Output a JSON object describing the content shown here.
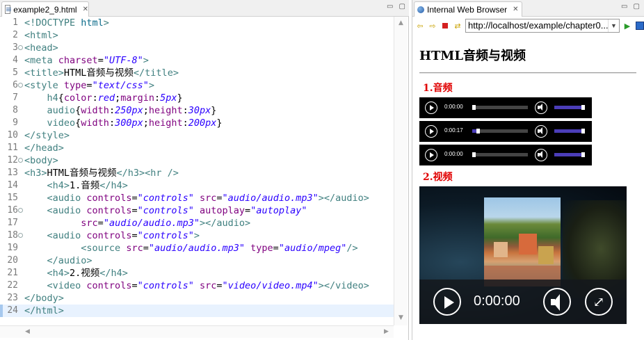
{
  "editor": {
    "tab_label": "example2_9.html",
    "tab_close": "✕",
    "min_label": "▭",
    "max_label": "▢",
    "lines": [
      {
        "n": "1",
        "parts": [
          [
            "t",
            "<!DOCTYPE "
          ],
          [
            "k",
            "html"
          ],
          [
            "t",
            ">"
          ]
        ]
      },
      {
        "n": "2",
        "parts": [
          [
            "t",
            "<html>"
          ]
        ]
      },
      {
        "n": "3",
        "fold": true,
        "parts": [
          [
            "t",
            "<head>"
          ]
        ]
      },
      {
        "n": "4",
        "parts": [
          [
            "t",
            "<meta "
          ],
          [
            "a",
            "charset"
          ],
          [
            "txt",
            "="
          ],
          [
            "v",
            "\"UTF-8\""
          ],
          [
            "t",
            ">"
          ]
        ]
      },
      {
        "n": "5",
        "parts": [
          [
            "t",
            "<title>"
          ],
          [
            "txt",
            "HTML音频与视频"
          ],
          [
            "t",
            "</title>"
          ]
        ]
      },
      {
        "n": "6",
        "fold": true,
        "parts": [
          [
            "t",
            "<style "
          ],
          [
            "a",
            "type"
          ],
          [
            "txt",
            "="
          ],
          [
            "v",
            "\"text/css\""
          ],
          [
            "t",
            ">"
          ]
        ]
      },
      {
        "n": "7",
        "parts": [
          [
            "txt",
            "    "
          ],
          [
            "sel",
            "h4"
          ],
          [
            "txt",
            "{"
          ],
          [
            "prop",
            "color"
          ],
          [
            "txt",
            ":"
          ],
          [
            "pv",
            "red"
          ],
          [
            "txt",
            ";"
          ],
          [
            "prop",
            "margin"
          ],
          [
            "txt",
            ":"
          ],
          [
            "pv",
            "5px"
          ],
          [
            "txt",
            "}"
          ]
        ]
      },
      {
        "n": "8",
        "parts": [
          [
            "txt",
            "    "
          ],
          [
            "sel",
            "audio"
          ],
          [
            "txt",
            "{"
          ],
          [
            "prop",
            "width"
          ],
          [
            "txt",
            ":"
          ],
          [
            "pv",
            "250px"
          ],
          [
            "txt",
            ";"
          ],
          [
            "prop",
            "height"
          ],
          [
            "txt",
            ":"
          ],
          [
            "pv",
            "30px"
          ],
          [
            "txt",
            "}"
          ]
        ]
      },
      {
        "n": "9",
        "parts": [
          [
            "txt",
            "    "
          ],
          [
            "sel",
            "video"
          ],
          [
            "txt",
            "{"
          ],
          [
            "prop",
            "width"
          ],
          [
            "txt",
            ":"
          ],
          [
            "pv",
            "300px"
          ],
          [
            "txt",
            ";"
          ],
          [
            "prop",
            "height"
          ],
          [
            "txt",
            ":"
          ],
          [
            "pv",
            "200px"
          ],
          [
            "txt",
            "}"
          ]
        ]
      },
      {
        "n": "10",
        "parts": [
          [
            "t",
            "</style>"
          ]
        ]
      },
      {
        "n": "11",
        "parts": [
          [
            "t",
            "</head>"
          ]
        ]
      },
      {
        "n": "12",
        "fold": true,
        "parts": [
          [
            "t",
            "<body>"
          ]
        ]
      },
      {
        "n": "13",
        "parts": [
          [
            "t",
            "<h3>"
          ],
          [
            "txt",
            "HTML音频与视频"
          ],
          [
            "t",
            "</h3><hr />"
          ]
        ]
      },
      {
        "n": "14",
        "parts": [
          [
            "txt",
            "    "
          ],
          [
            "t",
            "<h4>"
          ],
          [
            "txt",
            "1.音频"
          ],
          [
            "t",
            "</h4>"
          ]
        ]
      },
      {
        "n": "15",
        "parts": [
          [
            "txt",
            "    "
          ],
          [
            "t",
            "<audio "
          ],
          [
            "a",
            "controls"
          ],
          [
            "txt",
            "="
          ],
          [
            "v",
            "\"controls\""
          ],
          [
            "txt",
            " "
          ],
          [
            "a",
            "src"
          ],
          [
            "txt",
            "="
          ],
          [
            "v",
            "\"audio/audio.mp3\""
          ],
          [
            "t",
            "></audio>"
          ]
        ]
      },
      {
        "n": "16",
        "fold": true,
        "parts": [
          [
            "txt",
            "    "
          ],
          [
            "t",
            "<audio "
          ],
          [
            "a",
            "controls"
          ],
          [
            "txt",
            "="
          ],
          [
            "v",
            "\"controls\""
          ],
          [
            "txt",
            " "
          ],
          [
            "a",
            "autoplay"
          ],
          [
            "txt",
            "="
          ],
          [
            "v",
            "\"autoplay\""
          ]
        ]
      },
      {
        "n": "17",
        "parts": [
          [
            "txt",
            "          "
          ],
          [
            "a",
            "src"
          ],
          [
            "txt",
            "="
          ],
          [
            "v",
            "\"audio/audio.mp3\""
          ],
          [
            "t",
            "></audio>"
          ]
        ]
      },
      {
        "n": "18",
        "fold": true,
        "parts": [
          [
            "txt",
            "    "
          ],
          [
            "t",
            "<audio "
          ],
          [
            "a",
            "controls"
          ],
          [
            "txt",
            "="
          ],
          [
            "v",
            "\"controls\""
          ],
          [
            "t",
            ">"
          ]
        ]
      },
      {
        "n": "19",
        "parts": [
          [
            "txt",
            "          "
          ],
          [
            "t",
            "<source "
          ],
          [
            "a",
            "src"
          ],
          [
            "txt",
            "="
          ],
          [
            "v",
            "\"audio/audio.mp3\""
          ],
          [
            "txt",
            " "
          ],
          [
            "a",
            "type"
          ],
          [
            "txt",
            "="
          ],
          [
            "v",
            "\"audio/mpeg\""
          ],
          [
            "t",
            "/>"
          ]
        ]
      },
      {
        "n": "20",
        "parts": [
          [
            "txt",
            "    "
          ],
          [
            "t",
            "</audio>"
          ]
        ]
      },
      {
        "n": "21",
        "parts": [
          [
            "txt",
            "    "
          ],
          [
            "t",
            "<h4>"
          ],
          [
            "txt",
            "2.视频"
          ],
          [
            "t",
            "</h4>"
          ]
        ]
      },
      {
        "n": "22",
        "parts": [
          [
            "txt",
            "    "
          ],
          [
            "t",
            "<video "
          ],
          [
            "a",
            "controls"
          ],
          [
            "txt",
            "="
          ],
          [
            "v",
            "\"controls\""
          ],
          [
            "txt",
            " "
          ],
          [
            "a",
            "src"
          ],
          [
            "txt",
            "="
          ],
          [
            "v",
            "\"video/video.mp4\""
          ],
          [
            "t",
            "></video>"
          ]
        ]
      },
      {
        "n": "23",
        "parts": [
          [
            "t",
            "</body>"
          ]
        ]
      },
      {
        "n": "24",
        "current": true,
        "parts": [
          [
            "t",
            "</html>"
          ]
        ]
      }
    ]
  },
  "browser": {
    "tab_label": "Internal Web Browser",
    "tab_close": "✕",
    "url": "http://localhost/example/chapter0...",
    "toolbar_icons": [
      "back-icon",
      "forward-icon",
      "stop-icon",
      "refresh-icon",
      "go-icon",
      "external-browser-icon"
    ],
    "page": {
      "title": "HTML音频与视频",
      "section_audio": "1.音频",
      "section_video": "2.视频",
      "audios": [
        {
          "time": "0:00:00",
          "progress": 0.0,
          "volume": 1.0
        },
        {
          "time": "0:00:17",
          "progress": 0.1,
          "volume": 1.0
        },
        {
          "time": "0:00:00",
          "progress": 0.0,
          "volume": 1.0
        }
      ],
      "video_time": "0:00:00",
      "accent_color": "#4b3db8",
      "heading_color": "#e00000"
    }
  }
}
